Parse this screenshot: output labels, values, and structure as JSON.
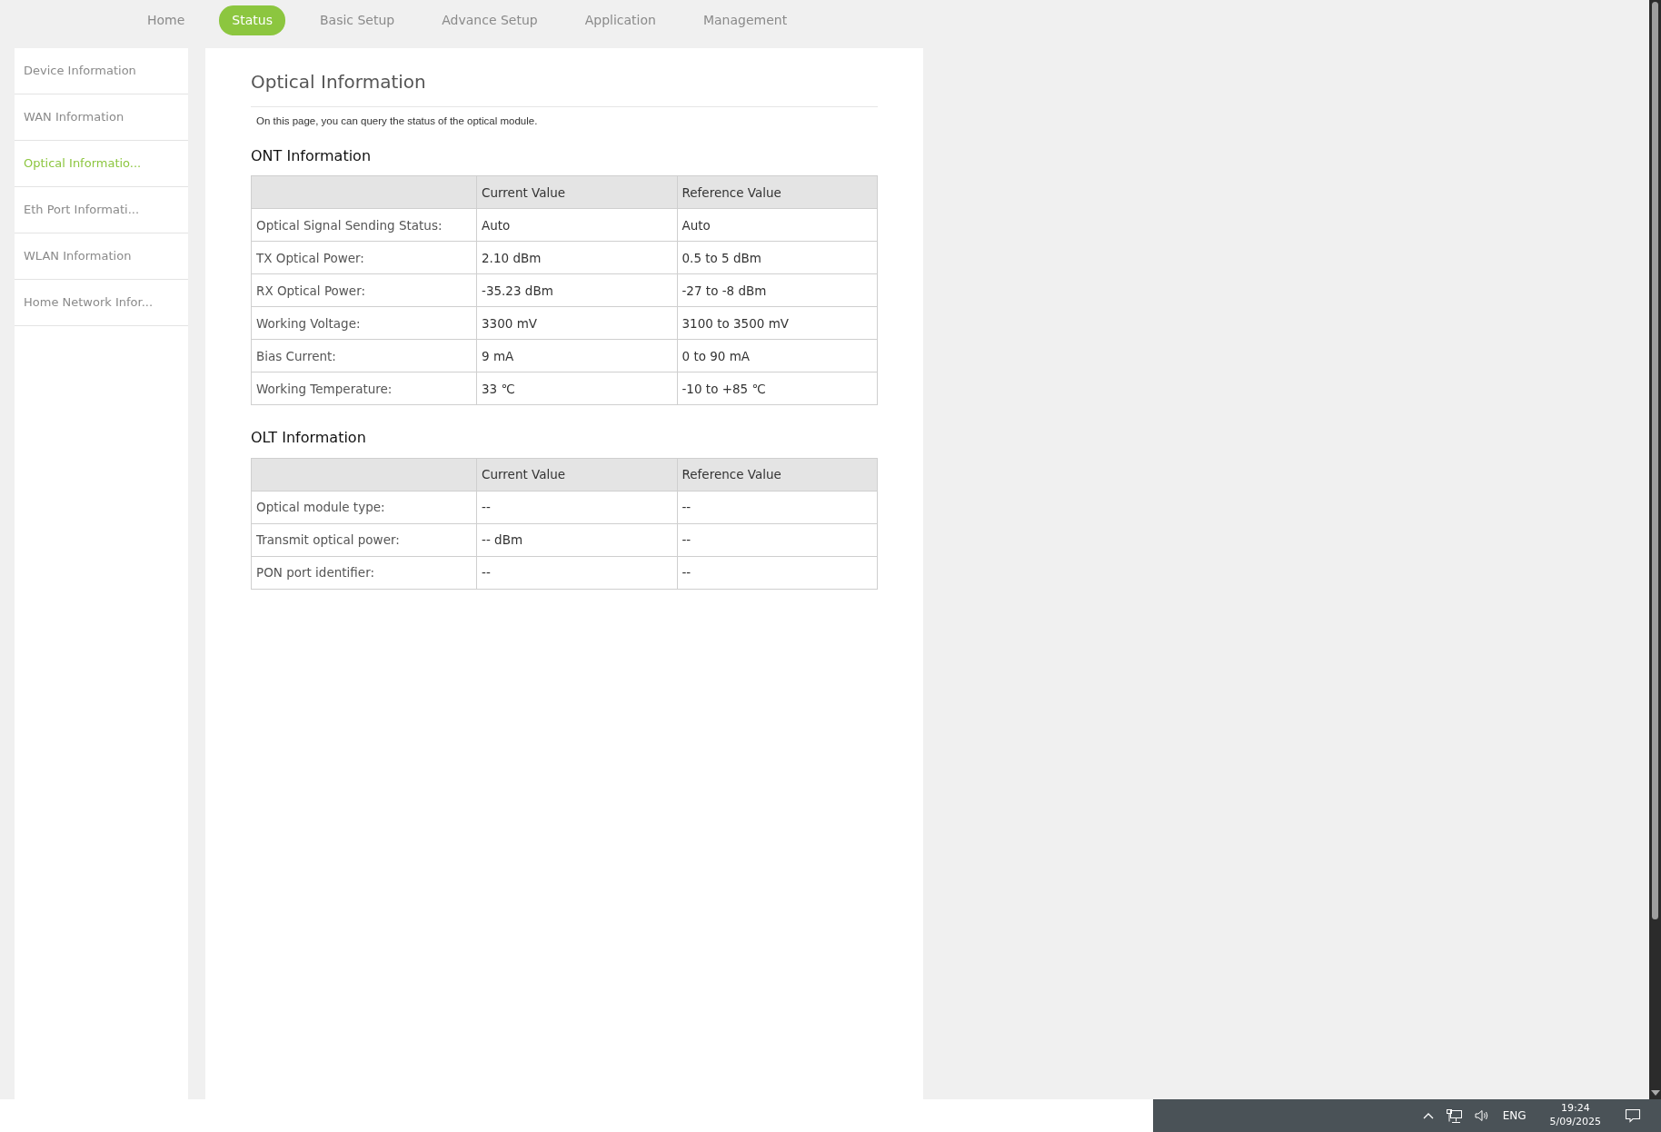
{
  "nav": [
    {
      "label": "Home",
      "selected": false
    },
    {
      "label": "Status",
      "selected": true
    },
    {
      "label": "Basic Setup",
      "selected": false
    },
    {
      "label": "Advance Setup",
      "selected": false
    },
    {
      "label": "Application",
      "selected": false
    },
    {
      "label": "Management",
      "selected": false
    }
  ],
  "sidebar": {
    "items": [
      {
        "label": "Device Information",
        "selected": false
      },
      {
        "label": "WAN Information",
        "selected": false
      },
      {
        "label": "Optical Informatio...",
        "selected": true
      },
      {
        "label": "Eth Port Informati...",
        "selected": false
      },
      {
        "label": "WLAN Information",
        "selected": false
      },
      {
        "label": "Home Network Infor...",
        "selected": false
      }
    ]
  },
  "page": {
    "title": "Optical Information",
    "description": "On this page, you can query the status of the optical module."
  },
  "sections": [
    {
      "title": "ONT Information",
      "columns": [
        "",
        "Current Value",
        "Reference Value"
      ],
      "rows": [
        [
          "Optical Signal Sending Status:",
          "Auto",
          "Auto"
        ],
        [
          "TX Optical Power:",
          "2.10 dBm",
          "0.5 to 5 dBm"
        ],
        [
          "RX Optical Power:",
          "-35.23 dBm",
          "-27 to -8 dBm"
        ],
        [
          "Working Voltage:",
          "3300 mV",
          "3100 to 3500 mV"
        ],
        [
          "Bias Current:",
          "9 mA",
          "0 to 90 mA"
        ],
        [
          "Working Temperature:",
          "33 ℃",
          "-10 to +85 ℃"
        ]
      ]
    },
    {
      "title": "OLT Information",
      "columns": [
        "",
        "Current Value",
        "Reference Value"
      ],
      "rows": [
        [
          "Optical module type:",
          "--",
          "--"
        ],
        [
          "Transmit optical power:",
          "-- dBm",
          "--"
        ],
        [
          "PON port identifier:",
          "--",
          "--"
        ]
      ]
    }
  ],
  "taskbar": {
    "language": "ENG",
    "time": "19:24",
    "date": "5/09/2025"
  }
}
